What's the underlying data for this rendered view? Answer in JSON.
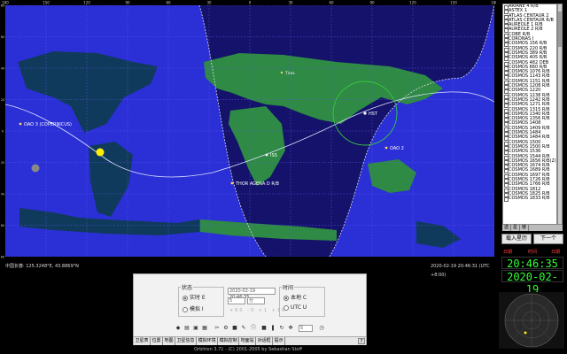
{
  "map": {
    "longitude_labels": [
      "180",
      "150",
      "120",
      "90",
      "60",
      "30",
      "0",
      "30",
      "60",
      "90",
      "120",
      "150",
      "180"
    ],
    "latitude_labels": [
      "80",
      "60",
      "40",
      "20",
      "0",
      "20",
      "40",
      "60",
      "80"
    ],
    "satellites": [
      {
        "label": "OAO 3 (COPERNICUS)"
      },
      {
        "label": "ISS"
      },
      {
        "label": "THOR AGENA D R/B"
      },
      {
        "label": "HST"
      },
      {
        "label": "OAO 2"
      },
      {
        "label": "Tiros"
      }
    ],
    "colors": {
      "night": "#14126a",
      "day": "#2b2fd6",
      "grid": "#5a5ae6",
      "land_day": "#2e8a44",
      "land_night": "#103a5c",
      "orbit": "#dfe6ff",
      "footprint": "#39c63f",
      "sun": "#ffee00",
      "terminator": "#e0e0e0"
    }
  },
  "coord_bar": {
    "cursor_position": "中国长春: 125.3248°E, 43.8869°N",
    "datetime": "2020-02-19 20:46:31 (UTC +8:00)"
  },
  "sat_list": {
    "items": [
      "ARIANE 4 R/B",
      "ASTEX 1",
      "ATLAS CENTAUR 2",
      "ATLAS CENTAUR R/B",
      "AUREOLE 1 R/B",
      "AUREOLE 2 R/B",
      "COBE R/B",
      "CORONAS I",
      "COSMOS 156 R/B",
      "COSMOS 220 R/B",
      "COSMOS 389 R/B",
      "COSMOS 405 R/B",
      "COSMOS 482 DEB",
      "COSMOS 660 R/B",
      "COSMOS 1076 R/B",
      "COSMOS 1143 R/B",
      "COSMOS 1151 R/B",
      "COSMOS 1208 R/B",
      "COSMOS 1220",
      "COSMOS 1238 R/B",
      "COSMOS 1242 R/B",
      "COSMOS 1271 R/B",
      "COSMOS 1315 R/B",
      "COSMOS 1340 R/B",
      "COSMOS 1356 R/B",
      "COSMOS 1408",
      "COSMOS 1409 R/B",
      "COSMOS 1484",
      "COSMOS 1484 R/B",
      "COSMOS 1500",
      "COSMOS 1500 R/B",
      "COSMOS 1536",
      "COSMOS 1544 R/B",
      "COSMOS 1656 R/B(2)",
      "COSMOS 1674 R/B",
      "COSMOS 1689 R/B",
      "COSMOS 1697 R/B",
      "COSMOS 1726 R/B",
      "COSMOS 1766 R/B",
      "COSMOS 1812",
      "COSMOS 1825 R/B",
      "COSMOS 1833 R/B"
    ]
  },
  "side_tabs": [
    "选",
    "星",
    "链"
  ],
  "buttons": {
    "load_satellites": "载入星历",
    "next": "下一个"
  },
  "clock": {
    "label_left": "日期",
    "label_mid": "时间",
    "label_right": "日期",
    "time": "20:46:35",
    "date": "2020-02-19"
  },
  "control_panel": {
    "state_label": "状态",
    "realtime_label": "实时 E",
    "simulate_label": "模拟 I",
    "datetime_value": "2020-02-19 20:46:35",
    "step_value": "5",
    "step_unit": "分",
    "ghost_values": "+60 -0 +1 +10",
    "time_label": "时间",
    "local_label": "本地 C",
    "utc_label": "UTC U",
    "speed_value": "5"
  },
  "bottom_tabs": [
    "卫星表",
    "位置",
    "地图",
    "卫星信息",
    "模拟环境",
    "模拟控制",
    "地面站",
    "对话框",
    "提示"
  ],
  "help_tab": "?",
  "status_bar": "Orbitron 3.71 - (C) 2001-2005 by Sebastian Stoff"
}
